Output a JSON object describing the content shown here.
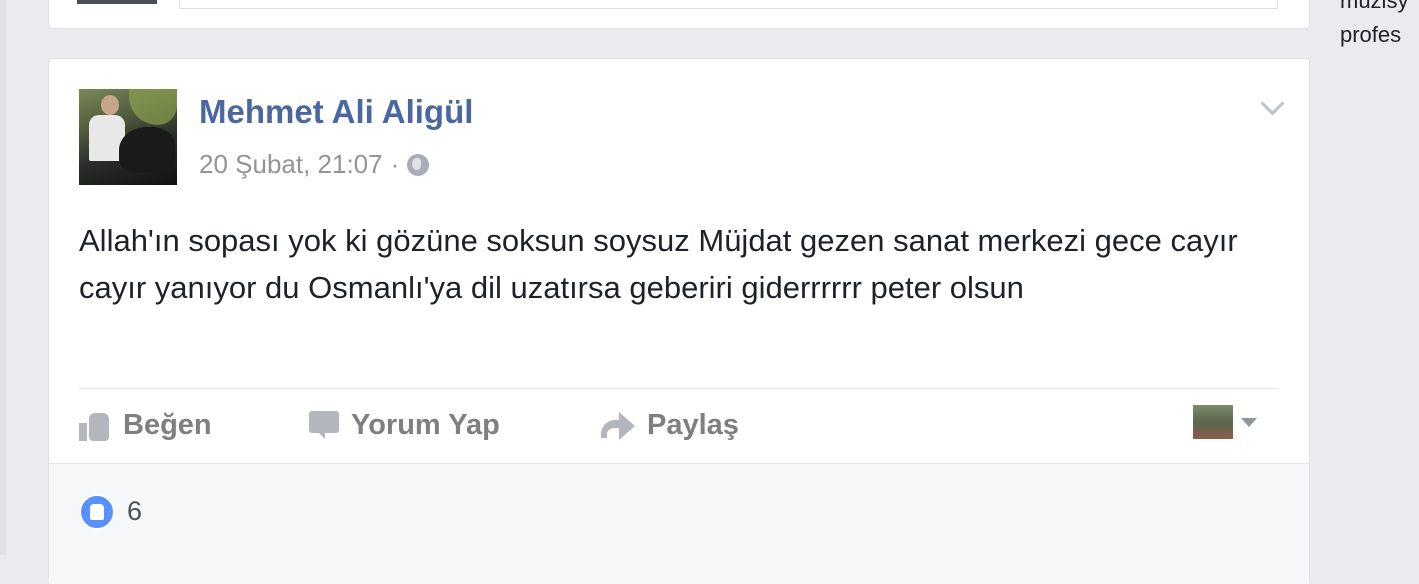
{
  "right_column": {
    "line1": "müzisy",
    "line2": "profes"
  },
  "post": {
    "author": "Mehmet Ali Aligül",
    "timestamp": "20 Şubat, 21:07",
    "separator": "·",
    "text": "Allah'ın sopası yok ki gözüne soksun soysuz Müjdat gezen sanat merkezi gece cayır cayır yanıyor du Osmanlı'ya dil uzatırsa geberiri giderrrrrr peter olsun",
    "actions": {
      "like": "Beğen",
      "comment": "Yorum Yap",
      "share": "Paylaş"
    },
    "reactions": {
      "count": "6"
    }
  },
  "colors": {
    "author": "#4b67a1",
    "like_blue": "#5890ff",
    "muted": "#90949c"
  }
}
